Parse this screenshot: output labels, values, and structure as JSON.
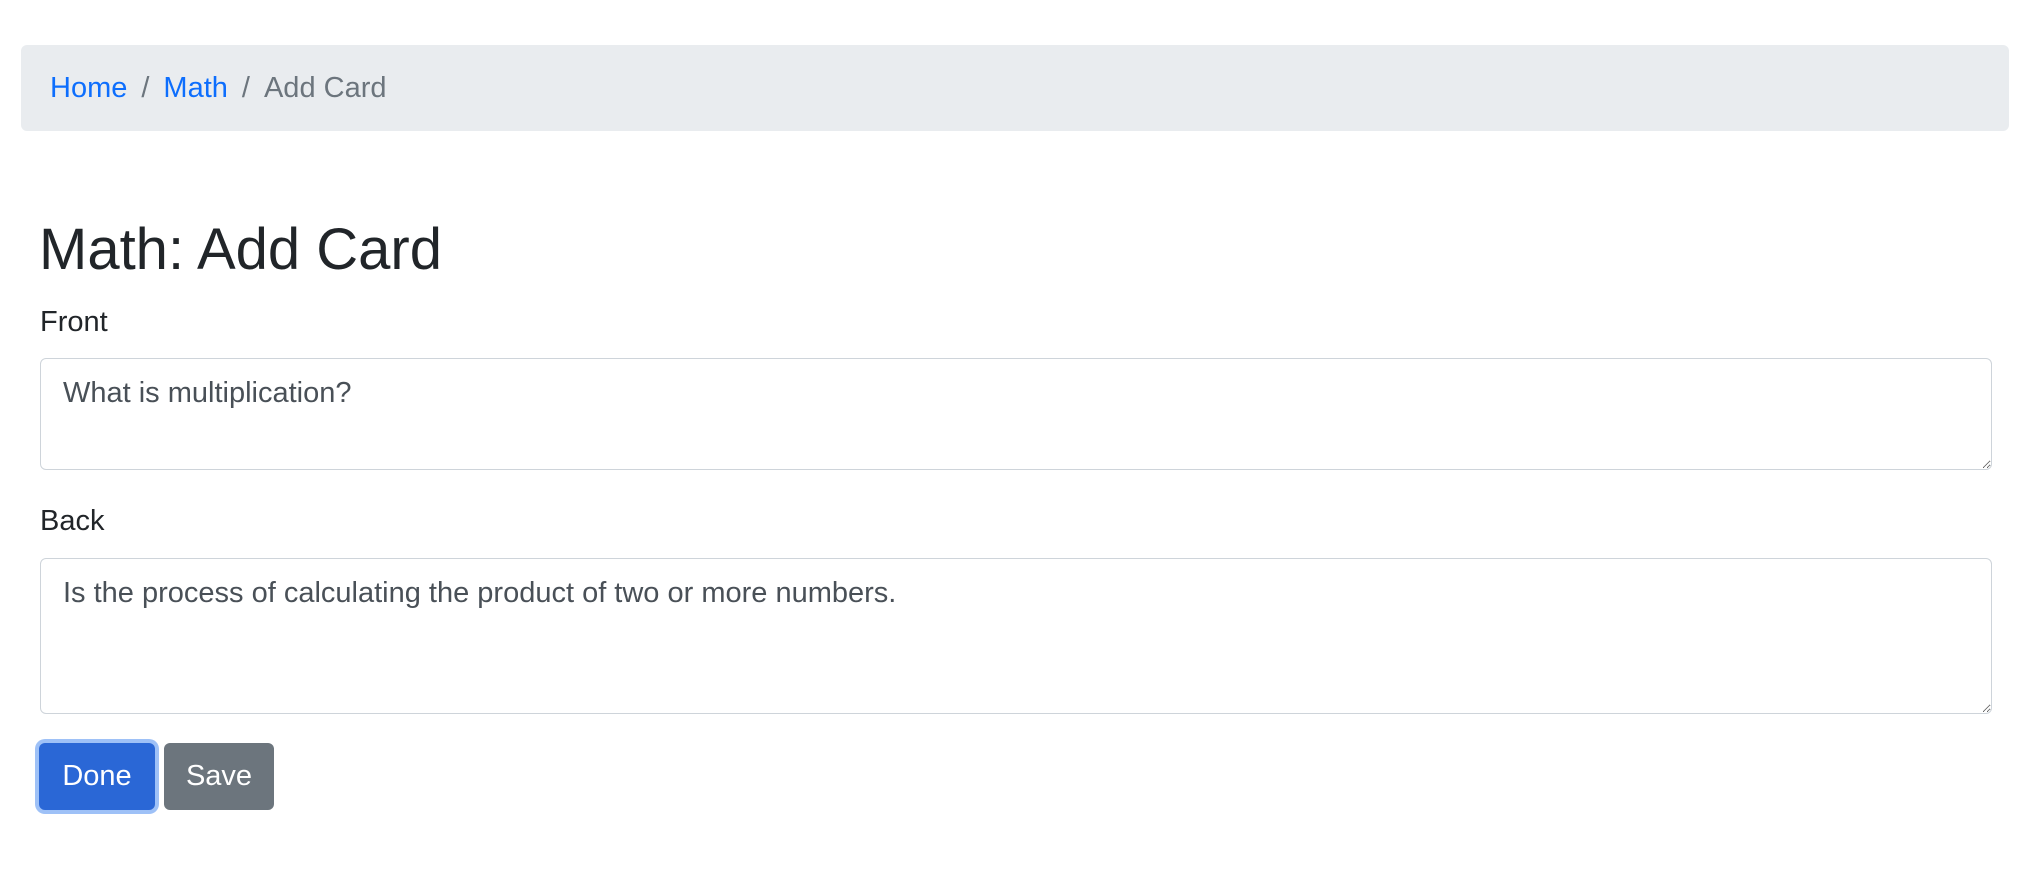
{
  "breadcrumb": {
    "home": "Home",
    "sep1": "/",
    "deck": "Math",
    "sep2": "/",
    "current": "Add Card"
  },
  "page": {
    "title": "Math: Add Card"
  },
  "form": {
    "front_label": "Front",
    "front_value": "What is multiplication?",
    "back_label": "Back",
    "back_value": "Is the process of calculating the product of two or more numbers."
  },
  "buttons": {
    "done": "Done",
    "save": "Save"
  },
  "colors": {
    "link": "#0d6efd",
    "primary": "#2a67d6",
    "secondary": "#6c757d",
    "breadcrumb_bg": "#e9ecef"
  }
}
